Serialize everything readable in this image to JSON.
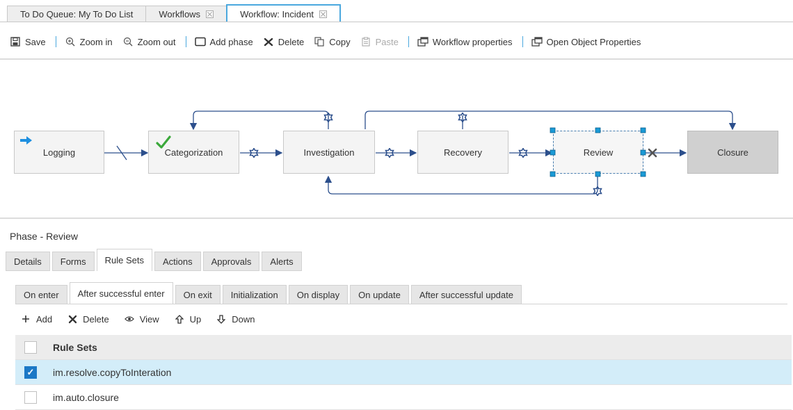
{
  "top_tabs": [
    {
      "label": "To Do Queue: My To Do List",
      "closable": false,
      "active": false
    },
    {
      "label": "Workflows",
      "closable": true,
      "active": false
    },
    {
      "label": "Workflow: Incident",
      "closable": true,
      "active": true
    }
  ],
  "toolbar": {
    "save": "Save",
    "zoom_in": "Zoom in",
    "zoom_out": "Zoom out",
    "add_phase": "Add phase",
    "delete": "Delete",
    "copy": "Copy",
    "paste": "Paste",
    "workflow_properties": "Workflow properties",
    "open_object_properties": "Open Object Properties"
  },
  "phases": {
    "logging": "Logging",
    "categorization": "Categorization",
    "investigation": "Investigation",
    "recovery": "Recovery",
    "review": "Review",
    "closure": "Closure"
  },
  "phase_panel": {
    "title": "Phase - Review",
    "tabs": [
      "Details",
      "Forms",
      "Rule Sets",
      "Actions",
      "Approvals",
      "Alerts"
    ],
    "active_tab": "Rule Sets"
  },
  "rule_tabs": {
    "tabs": [
      "On enter",
      "After successful enter",
      "On exit",
      "Initialization",
      "On display",
      "On update",
      "After successful update"
    ],
    "active_tab": "After successful enter"
  },
  "actions": {
    "add": "Add",
    "delete": "Delete",
    "view": "View",
    "up": "Up",
    "down": "Down"
  },
  "table": {
    "header": "Rule Sets",
    "rows": [
      {
        "name": "im.resolve.copyToInteration",
        "checked": true
      },
      {
        "name": "im.auto.closure",
        "checked": false
      }
    ]
  },
  "colors": {
    "accent": "#4aa8de",
    "selected_row": "#d3edf9",
    "checkbox_checked": "#1b78c6",
    "transition": "#2c4f8c",
    "start_arrow": "#1e8fe0",
    "check_mark": "#3aa83a"
  }
}
